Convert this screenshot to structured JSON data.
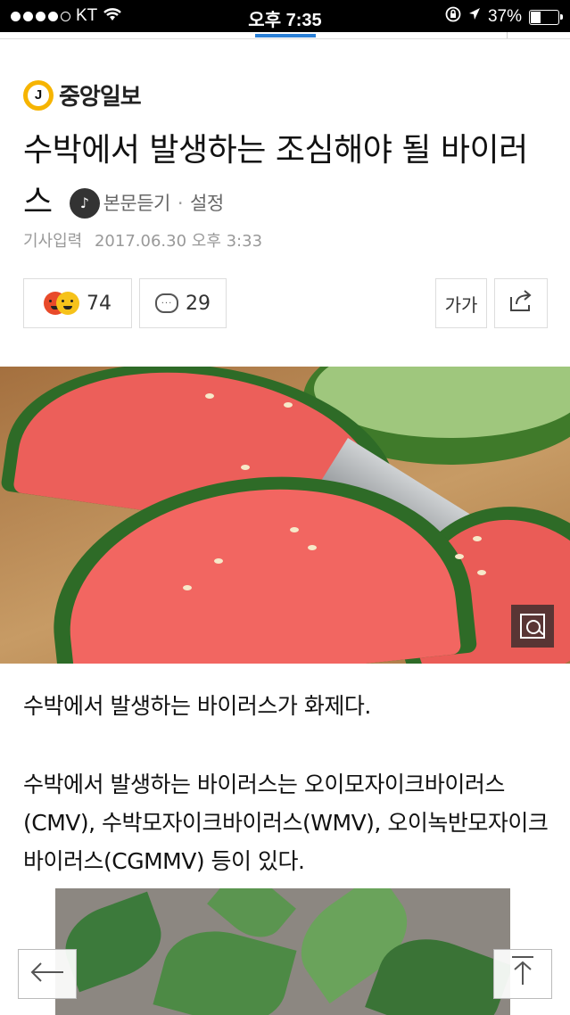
{
  "status": {
    "carrier": "KT",
    "time": "오후 7:35",
    "battery": "37%"
  },
  "publisher": {
    "logo_letter": "J",
    "name": "중앙일보"
  },
  "article": {
    "title": "수박에서 발생하는 조심해야 될 바이러스",
    "tts_label": "본문듣기",
    "settings_label": "설정",
    "date_label": "기사입력",
    "date": "2017.06.30 오후 3:33"
  },
  "actions": {
    "reaction_count": "74",
    "comment_count": "29",
    "font_label": "가가"
  },
  "body": {
    "paragraph1": "수박에서 발생하는 바이러스가 화제다.",
    "paragraph2": "수박에서 발생하는 바이러스는 오이모자이크바이러스(CMV), 수박모자이크바이러스(WMV), 오이녹반모자이크바이러스(CGMMV) 등이 있다."
  },
  "icons": {
    "back": "arrow-left-icon",
    "top": "arrow-up-icon",
    "zoom": "zoom-icon",
    "share": "share-icon",
    "comment": "comment-icon"
  },
  "colors": {
    "tab_indicator": "#2a7fd6",
    "logo": "#f6b400"
  }
}
